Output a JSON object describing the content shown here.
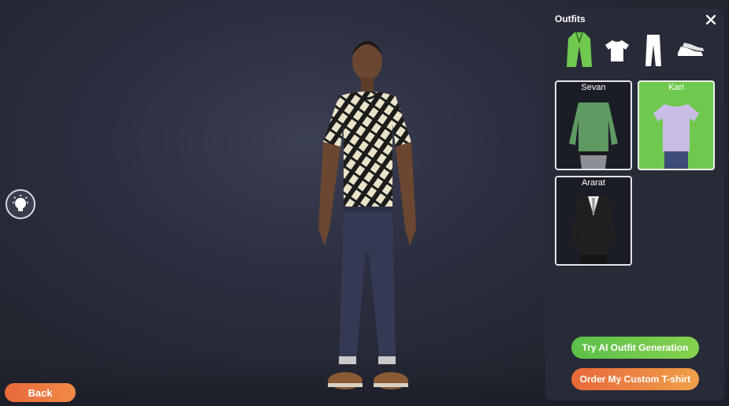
{
  "panel": {
    "title": "Outfits",
    "close_icon": "close-icon",
    "categories": [
      {
        "name": "full-outfit",
        "icon": "coat-icon",
        "active": true
      },
      {
        "name": "tops",
        "icon": "tshirt-icon",
        "active": false
      },
      {
        "name": "bottoms",
        "icon": "pants-icon",
        "active": false
      },
      {
        "name": "shoes",
        "icon": "shoes-icon",
        "active": false
      }
    ],
    "outfits": [
      {
        "label": "Sevan",
        "selected": false
      },
      {
        "label": "Kari",
        "selected": true
      },
      {
        "label": "Ararat",
        "selected": false
      }
    ],
    "ai_button": "Try AI Outfit Generation",
    "order_button": "Order My Custom T-shirt"
  },
  "back_button": "Back",
  "hint_icon": "lightbulb-icon",
  "colors": {
    "accent_green": "#6fc94f",
    "accent_orange": "#e8683a",
    "panel_bg": "#272a37"
  }
}
